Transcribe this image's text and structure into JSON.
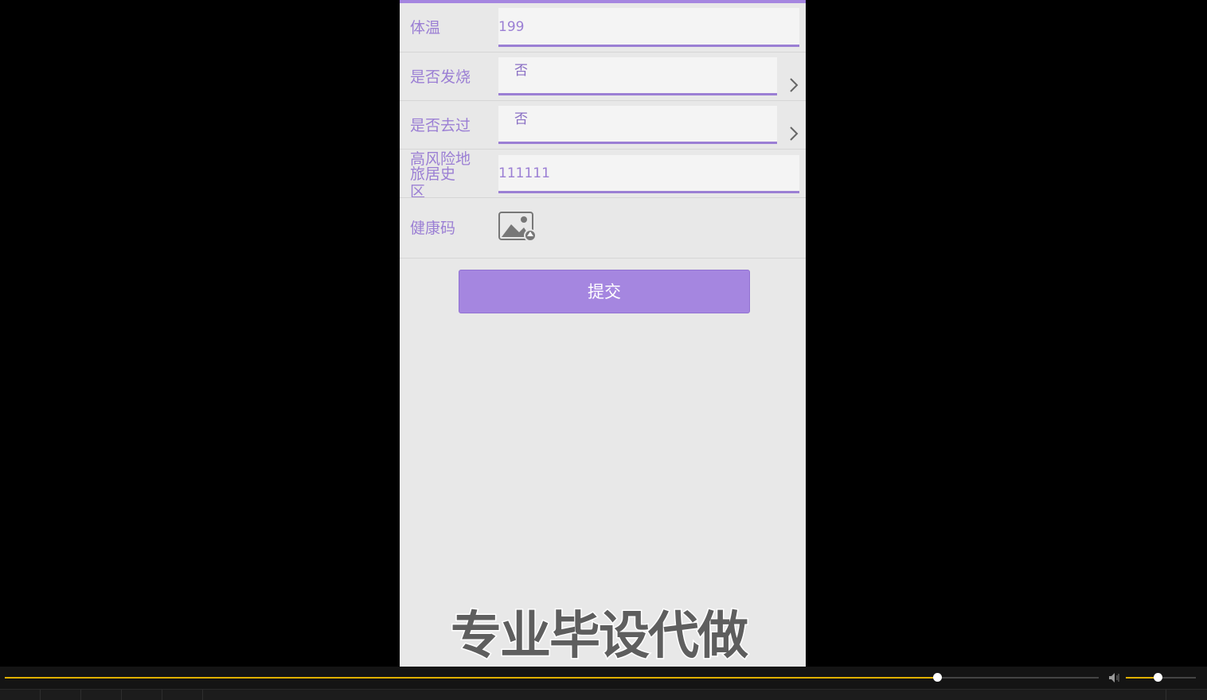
{
  "form": {
    "temperature": {
      "label": "体温",
      "value": "199"
    },
    "fever": {
      "label": "是否发烧",
      "value": "否"
    },
    "visited": {
      "label": "是否去过",
      "value": "否"
    },
    "travel": {
      "label_line1": "高风险地",
      "label_line2": "旅居史",
      "label_line3": "区",
      "value": "111111"
    },
    "health_code": {
      "label": "健康码"
    }
  },
  "submit_label": "提交",
  "watermark": "专业毕设代做",
  "player": {
    "progress": 0.852,
    "volume": 0.45
  },
  "colors": {
    "accent": "#a586e0",
    "label": "#9b7fd4"
  }
}
